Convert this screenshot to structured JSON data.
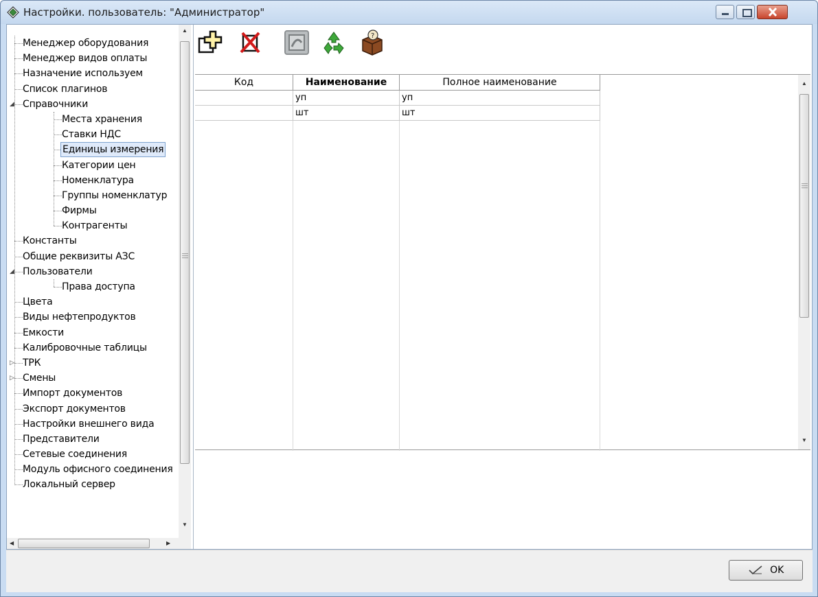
{
  "window": {
    "title": "Настройки. пользователь: \"Администратор\"",
    "icon": "diamond-app-icon"
  },
  "toolbar": {
    "buttons": [
      {
        "name": "add",
        "icon": "add-record-icon"
      },
      {
        "name": "delete",
        "icon": "delete-record-icon"
      },
      {
        "name": "edit",
        "icon": "edit-record-icon"
      },
      {
        "name": "refresh",
        "icon": "recycle-icon"
      },
      {
        "name": "help",
        "icon": "help-box-icon"
      }
    ]
  },
  "tree": {
    "items": [
      {
        "label": "Менеджер оборудования",
        "level": 0
      },
      {
        "label": "Менеджер видов оплаты",
        "level": 0
      },
      {
        "label": "Назначение используем",
        "level": 0
      },
      {
        "label": "Список плагинов",
        "level": 0
      },
      {
        "label": "Справочники",
        "level": 0,
        "expanded": true
      },
      {
        "label": "Места хранения",
        "level": 1
      },
      {
        "label": "Ставки НДС",
        "level": 1
      },
      {
        "label": "Единицы измерения",
        "level": 1,
        "selected": true
      },
      {
        "label": "Категории цен",
        "level": 1
      },
      {
        "label": "Номенклатура",
        "level": 1
      },
      {
        "label": "Группы номенклатур",
        "level": 1
      },
      {
        "label": "Фирмы",
        "level": 1
      },
      {
        "label": "Контрагенты",
        "level": 1
      },
      {
        "label": "Константы",
        "level": 0
      },
      {
        "label": "Общие реквизиты АЗС",
        "level": 0
      },
      {
        "label": "Пользователи",
        "level": 0,
        "expanded": true
      },
      {
        "label": "Права доступа",
        "level": 1
      },
      {
        "label": "Цвета",
        "level": 0
      },
      {
        "label": "Виды нефтепродуктов",
        "level": 0
      },
      {
        "label": "Емкости",
        "level": 0
      },
      {
        "label": "Калибровочные таблицы",
        "level": 0
      },
      {
        "label": "ТРК",
        "level": 0,
        "collapsed": true
      },
      {
        "label": "Смены",
        "level": 0,
        "collapsed": true
      },
      {
        "label": "Импорт документов",
        "level": 0
      },
      {
        "label": "Экспорт документов",
        "level": 0
      },
      {
        "label": "Настройки внешнего вида",
        "level": 0
      },
      {
        "label": "Представители",
        "level": 0
      },
      {
        "label": "Сетевые соединения",
        "level": 0
      },
      {
        "label": "Модуль офисного соединения",
        "level": 0
      },
      {
        "label": "Локальный сервер",
        "level": 0
      }
    ]
  },
  "grid": {
    "columns": [
      "Код",
      "Наименование",
      "Полное наименование"
    ],
    "rows": [
      [
        "",
        "уп",
        "уп"
      ],
      [
        "",
        "шт",
        "шт"
      ]
    ]
  },
  "footer": {
    "ok_label": "OK"
  }
}
